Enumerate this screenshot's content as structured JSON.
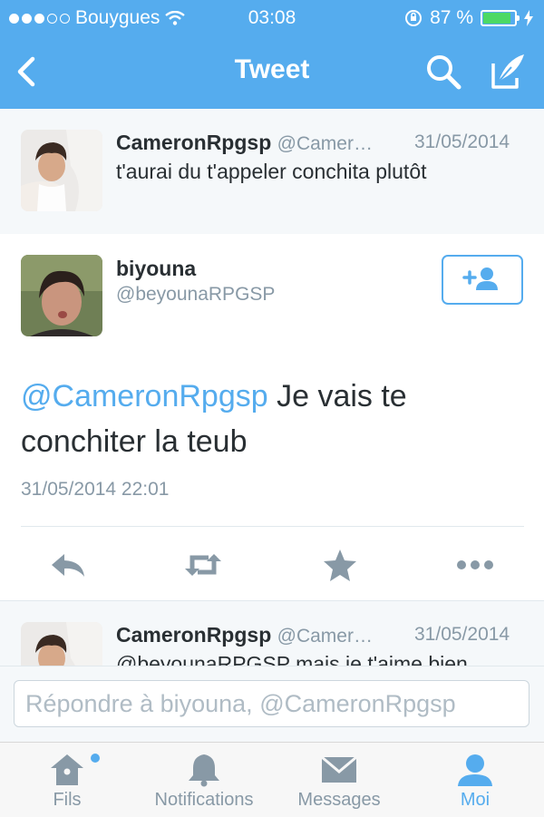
{
  "status_bar": {
    "carrier": "Bouygues",
    "time": "03:08",
    "battery": "87 %",
    "battery_level": 0.87,
    "signal_bars": 3
  },
  "nav": {
    "title": "Tweet",
    "icons": [
      "back-chevron-icon",
      "search-icon",
      "compose-icon"
    ]
  },
  "parent_tweet": {
    "name": "CameronRpgsp",
    "handle": "@Camer…",
    "date": "31/05/2014",
    "text": "t'aurai du t'appeler conchita plutôt"
  },
  "main_tweet": {
    "name": "biyouna",
    "handle": "@beyounaRPGSP",
    "mention": "@CameronRpgsp",
    "text": " Je vais te conchiter la teub",
    "timestamp": "31/05/2014 22:01",
    "actions": [
      "reply-icon",
      "retweet-icon",
      "favorite-icon",
      "more-icon"
    ]
  },
  "reply_tweet": {
    "name": "CameronRpgsp",
    "handle": "@Camer…",
    "date": "31/05/2014",
    "text": "@beyounaRPGSP mais je t'aime bien"
  },
  "reply_input": {
    "placeholder": "Répondre à biyouna, @CameronRpgsp",
    "value": ""
  },
  "tabs": [
    {
      "label": "Fils",
      "icon": "home-icon"
    },
    {
      "label": "Notifications",
      "icon": "bell-icon"
    },
    {
      "label": "Messages",
      "icon": "envelope-icon"
    },
    {
      "label": "Moi",
      "icon": "person-icon",
      "active": true
    }
  ],
  "colors": {
    "brand": "#55acee",
    "text": "#292f33",
    "muted": "#8899a6",
    "battery": "#4cd964"
  }
}
